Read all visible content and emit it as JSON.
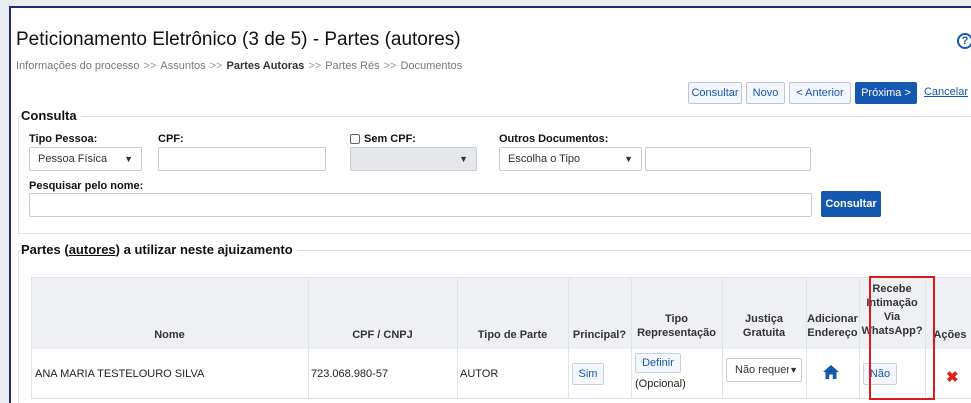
{
  "header": {
    "title": "Peticionamento Eletrônico (3 de 5) - Partes (autores)",
    "help_icon": "question-circle-icon"
  },
  "breadcrumb": {
    "items": [
      "Informações do processo",
      "Assuntos",
      "Partes Autoras",
      "Partes Rés",
      "Documentos"
    ],
    "separator": ">>"
  },
  "toolbar": {
    "consultar": "Consultar",
    "novo": "Novo",
    "anterior": "< Anterior",
    "proxima": "Próxima >",
    "cancelar": "Cancelar"
  },
  "consulta": {
    "title": "Consulta",
    "tipo_pessoa_label": "Tipo Pessoa:",
    "tipo_pessoa_value": "Pessoa Física",
    "cpf_label": "CPF:",
    "cpf_value": "",
    "sem_cpf_label": "Sem CPF:",
    "outros_documentos_label": "Outros Documentos:",
    "outros_documentos_value": "Escolha o Tipo",
    "outros_documentos_number": "",
    "pesquisar_label": "Pesquisar pelo nome:",
    "pesquisar_value": "",
    "consultar_button": "Consultar"
  },
  "partes": {
    "title_prefix": "Partes (",
    "title_link": "autores",
    "title_suffix": ") a utilizar neste ajuizamento",
    "columns": {
      "nome": "Nome",
      "cpf": "CPF / CNPJ",
      "tipo_parte": "Tipo de Parte",
      "principal": "Principal?",
      "tipo_rep_1": "Tipo",
      "tipo_rep_2": "Representação",
      "justica_1": "Justiça",
      "justica_2": "Gratuita",
      "adicionar_1": "Adicionar",
      "adicionar_2": "Endereço",
      "recebe_1": "Recebe",
      "recebe_2": "Intimação",
      "recebe_3": "Via",
      "recebe_4": "WhatsApp?",
      "acoes": "Ações"
    },
    "rows": [
      {
        "nome": "ANA MARIA TESTELOURO SILVA",
        "cpf": "723.068.980-57",
        "tipo_parte": "AUTOR",
        "principal": "Sim",
        "representacao_button": "Definir",
        "representacao_note": "(Opcional)",
        "justica_gratuita": "Não requerid",
        "whatsapp": "Não"
      }
    ]
  },
  "colors": {
    "primary": "#1558b0",
    "highlight": "#e0181b",
    "delete": "#d9231e"
  }
}
